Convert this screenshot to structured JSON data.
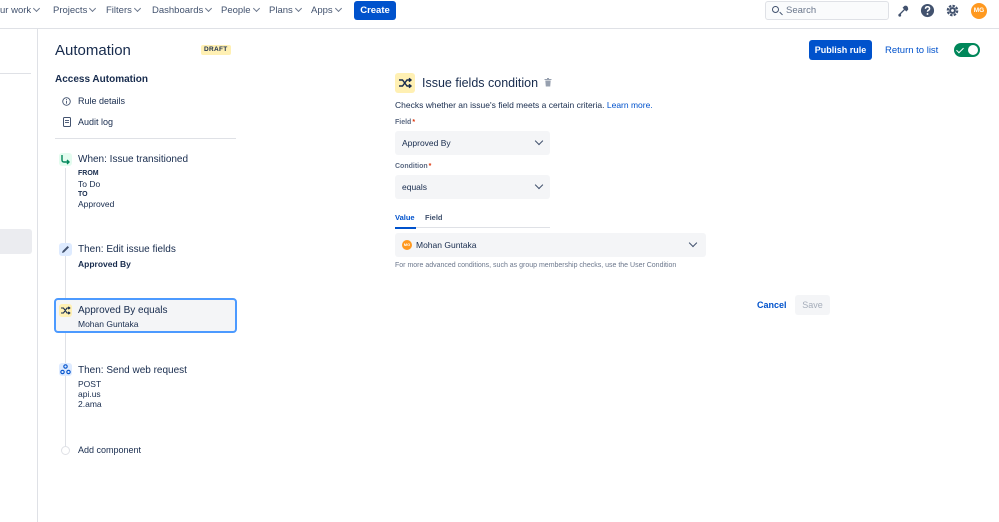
{
  "topnav": {
    "items": [
      {
        "label": "ur work"
      },
      {
        "label": "Projects"
      },
      {
        "label": "Filters"
      },
      {
        "label": "Dashboards"
      },
      {
        "label": "People"
      },
      {
        "label": "Plans"
      },
      {
        "label": "Apps"
      }
    ],
    "create_label": "Create",
    "search_placeholder": "Search",
    "user_initials": "MG"
  },
  "sidebar": {
    "title": "Automation",
    "draft_badge": "DRAFT",
    "section_title": "Access Automation",
    "links": [
      {
        "label": "Rule details",
        "icon": "info-icon"
      },
      {
        "label": "Audit log",
        "icon": "document-icon"
      }
    ],
    "components": [
      {
        "title": "When: Issue transitioned",
        "from_label": "FROM",
        "from_value": "To Do",
        "to_label": "TO",
        "to_value": "Approved",
        "icon": "transition-icon"
      },
      {
        "title": "Then: Edit issue fields",
        "subtitle": "Approved By",
        "icon": "pencil-icon"
      },
      {
        "title": "Approved By equals",
        "subtitle": "Mohan Guntaka",
        "icon": "shuffle-icon"
      },
      {
        "title": "Then: Send web request",
        "line1": "POST",
        "line2": "api.us",
        "line3": "2.ama",
        "icon": "webhook-icon"
      }
    ],
    "add_component": "Add component"
  },
  "header": {
    "publish_label": "Publish rule",
    "return_label": "Return to list",
    "rule_enabled": true
  },
  "panel": {
    "title": "Issue fields condition",
    "description": "Checks whether an issue's field meets a certain criteria.",
    "learn_more": "Learn more.",
    "field_label": "Field",
    "field_value": "Approved By",
    "condition_label": "Condition",
    "condition_value": "equals",
    "tabs": [
      {
        "label": "Value"
      },
      {
        "label": "Field"
      }
    ],
    "value_user": "Mohan Guntaka",
    "value_user_initials": "MG",
    "help_text": "For more advanced conditions, such as group membership checks, use the User Condition",
    "cancel_label": "Cancel",
    "save_label": "Save"
  },
  "colors": {
    "brand": "#0052CC",
    "success": "#00875A",
    "draft_bg": "#FFF0B3",
    "focus": "#4C9AFF"
  }
}
